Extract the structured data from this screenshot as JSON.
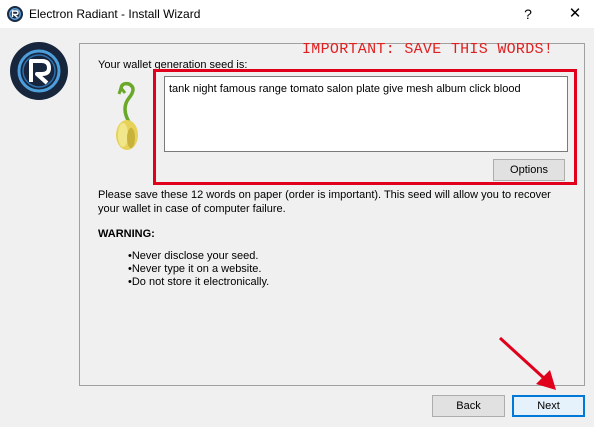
{
  "window": {
    "title": "Electron Radiant  -  Install Wizard",
    "help_symbol": "?",
    "close_symbol": "✕"
  },
  "banner": {
    "important_text": "IMPORTANT: SAVE THIS WORDS!",
    "important_color": "#e02020"
  },
  "seed": {
    "label": "Your wallet generation seed is:",
    "words": "tank night famous range tomato salon plate give mesh album click blood",
    "options_label": "Options"
  },
  "info": {
    "description": "Please save these 12 words on paper (order is important). This seed will allow you to recover your wallet in case of computer failure.",
    "warning_title": "WARNING:",
    "warnings": [
      "Never disclose your seed.",
      "Never type it on a website.",
      "Do not store it electronically."
    ]
  },
  "footer": {
    "back_label": "Back",
    "next_label": "Next"
  },
  "icons": {
    "app": "electron-radiant-icon",
    "logo": "electron-radiant-logo",
    "sprout": "seed-sprout-icon",
    "arrow": "red-arrow-annotation"
  }
}
